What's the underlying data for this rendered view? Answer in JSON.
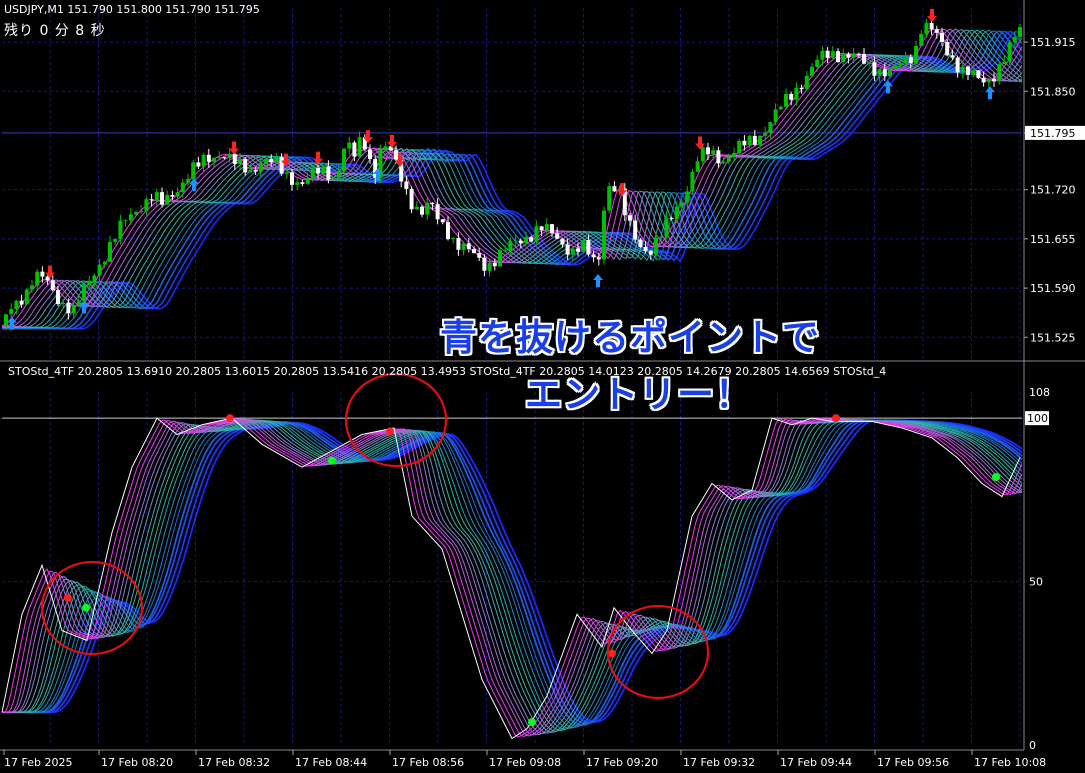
{
  "header": {
    "symbol_line": "USDJPY,M1  151.790 151.800 151.790 151.795",
    "countdown": "残り 0 分 8 秒"
  },
  "indicator_line": "STOStd_4TF 20.2805 13.6910 20.2805 13.6015 20.2805 13.5416 20.2805 13.4953  STOStd_4TF 20.2805 14.0123 20.2805 14.2679 20.2805 14.6569  STOStd_4",
  "caption": {
    "line1": "青を抜けるポイントで",
    "line2": "エントリー！"
  },
  "colors": {
    "background": "#000000",
    "grid": "#1b1b7a",
    "bull_candle": "#00c000",
    "bear_candle": "#ffffff",
    "sell_arrow": "#ff2020",
    "buy_arrow": "#1e90ff",
    "stoch_fast": "#ffffff",
    "ribbon_fast": "#ff30ff",
    "ribbon_mid": "#20c0a0",
    "ribbon_slow": "#1a2aff",
    "circle": "#e01010",
    "cross_dot_green": "#00ff20",
    "cross_dot_red": "#ff2020"
  },
  "chart_data": [
    {
      "type": "candlestick",
      "title": "USDJPY,M1",
      "y_ticks": [
        "151.915",
        "151.850",
        "151.795",
        "151.720",
        "151.655",
        "151.590",
        "151.525"
      ],
      "current_price": "151.795",
      "ylim": [
        151.495,
        151.96
      ],
      "close_path": {
        "x": [
          0,
          8,
          16,
          24,
          30,
          38,
          46,
          54,
          62,
          72,
          84,
          96,
          110,
          124,
          138,
          150,
          160,
          170,
          180,
          190,
          196,
          204,
          212,
          220,
          228,
          236,
          248,
          260,
          272,
          282,
          292,
          300,
          312,
          324,
          334,
          340,
          346,
          352,
          360,
          366,
          372,
          380,
          388,
          396,
          404,
          412,
          420,
          428,
          436,
          444,
          454,
          464,
          474,
          484,
          494,
          504,
          514,
          526,
          538,
          550,
          560,
          570,
          580,
          588,
          596,
          602,
          608,
          616,
          624,
          636,
          648,
          660,
          672,
          684,
          696,
          708,
          720,
          732,
          744,
          756,
          768,
          780,
          792,
          804,
          816,
          828,
          840,
          852,
          864,
          876,
          888,
          900,
          912,
          920,
          930,
          940,
          950,
          960,
          970,
          980,
          990,
          1000,
          1010,
          1016
        ],
        "close": [
          151.54,
          151.56,
          151.575,
          151.585,
          151.6,
          151.605,
          151.595,
          151.58,
          151.57,
          151.56,
          151.59,
          151.62,
          151.65,
          151.68,
          151.7,
          151.71,
          151.7,
          151.715,
          151.73,
          151.745,
          151.75,
          151.76,
          151.765,
          151.77,
          151.76,
          151.75,
          151.745,
          151.76,
          151.755,
          151.74,
          151.735,
          151.73,
          151.74,
          151.745,
          151.735,
          151.77,
          151.78,
          151.76,
          151.79,
          151.77,
          151.74,
          151.78,
          151.77,
          151.745,
          151.72,
          151.7,
          151.69,
          151.7,
          151.68,
          151.67,
          151.65,
          151.64,
          151.63,
          151.62,
          151.63,
          151.64,
          151.65,
          151.66,
          151.67,
          151.66,
          151.65,
          151.64,
          151.645,
          151.63,
          151.62,
          151.7,
          151.73,
          151.72,
          151.68,
          151.65,
          151.64,
          151.66,
          151.69,
          151.72,
          151.76,
          151.77,
          151.76,
          151.77,
          151.78,
          151.79,
          151.81,
          151.83,
          151.85,
          151.87,
          151.89,
          151.9,
          151.9,
          151.895,
          151.885,
          151.88,
          151.875,
          151.885,
          151.9,
          151.94,
          151.93,
          151.91,
          151.895,
          151.88,
          151.87,
          151.86,
          151.87,
          151.89,
          151.91,
          151.93
        ]
      },
      "sell_arrow_bars": [
        48,
        232,
        284,
        316,
        366,
        390,
        398,
        620,
        698,
        930
      ],
      "buy_arrow_bars": [
        10,
        82,
        192,
        376,
        596,
        886,
        988
      ]
    },
    {
      "type": "line",
      "title": "STOStd_4TF",
      "y_ticks": [
        "108",
        "100",
        "50",
        "0"
      ],
      "ylim": [
        0,
        108
      ],
      "x_labels": [
        "17 Feb 2025",
        "17 Feb 08:20",
        "17 Feb 08:32",
        "17 Feb 08:44",
        "17 Feb 08:56",
        "17 Feb 09:08",
        "17 Feb 09:20",
        "17 Feb 09:32",
        "17 Feb 09:44",
        "17 Feb 09:56",
        "17 Feb 10:08"
      ],
      "series": [
        {
          "x": [
            0,
            20,
            40,
            60,
            85,
            110,
            130,
            155,
            175,
            200,
            230,
            260,
            300,
            330,
            360,
            392,
            410,
            440,
            480,
            510,
            525,
            545,
            575,
            600,
            612,
            630,
            650,
            665,
            690,
            710,
            730,
            750,
            770,
            790,
            810,
            830,
            850,
            870,
            900,
            930,
            955,
            980,
            1000,
            1018
          ],
          "values": [
            10,
            40,
            55,
            35,
            32,
            65,
            85,
            100,
            95,
            98,
            100,
            92,
            85,
            90,
            95,
            97,
            70,
            60,
            20,
            2,
            5,
            15,
            40,
            30,
            42,
            35,
            28,
            35,
            70,
            80,
            75,
            78,
            100,
            98,
            100,
            99,
            99,
            99,
            97,
            94,
            88,
            80,
            76,
            88
          ]
        }
      ],
      "markers_red": [
        [
          66,
          45
        ],
        [
          228,
          100
        ],
        [
          388,
          96
        ],
        [
          610,
          28
        ],
        [
          834,
          100
        ]
      ],
      "markers_green": [
        [
          84,
          42
        ],
        [
          330,
          87
        ],
        [
          530,
          7
        ],
        [
          994,
          82
        ]
      ],
      "circles": [
        [
          92,
          608
        ],
        [
          396,
          420
        ],
        [
          658,
          652
        ]
      ]
    }
  ]
}
